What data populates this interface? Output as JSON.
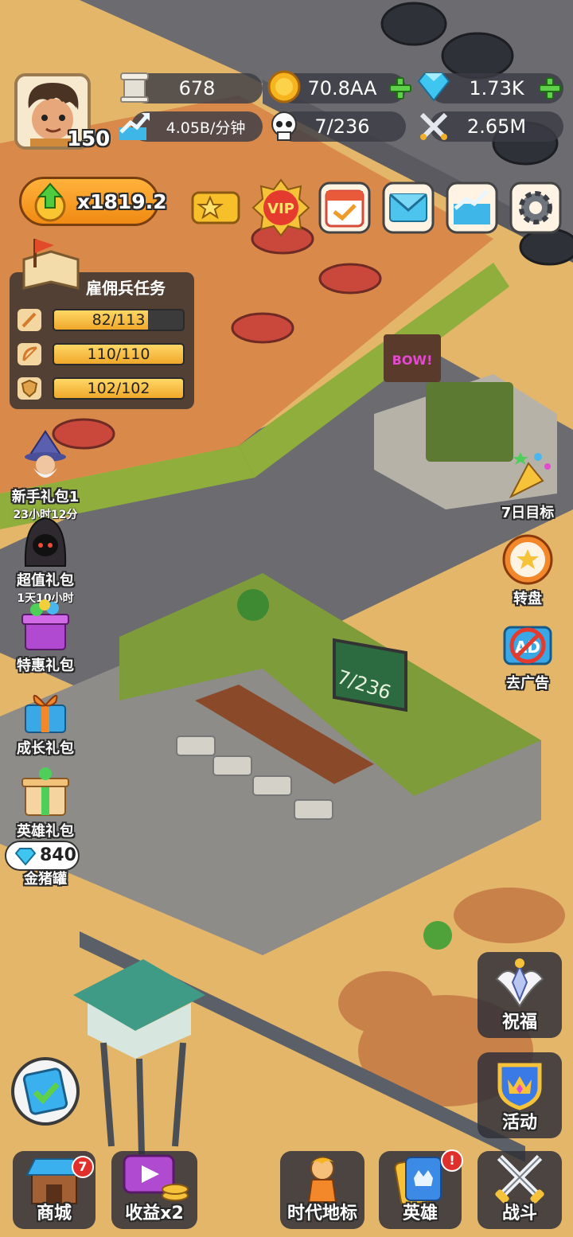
{
  "player": {
    "level": "150"
  },
  "resources": {
    "stone": "678",
    "gold": "70.8AA",
    "diamonds": "1.73K",
    "income_rate": "4.05B/分钟",
    "population": "7/236",
    "power": "2.65M"
  },
  "boost": {
    "multiplier": "x1819.2"
  },
  "top_buttons": [
    {
      "name": "pass-ticket",
      "icon": "ticket-star-icon"
    },
    {
      "name": "vip",
      "label": "VIP",
      "icon": "vip-badge-icon"
    },
    {
      "name": "calendar",
      "icon": "calendar-check-icon"
    },
    {
      "name": "mail",
      "icon": "mail-icon"
    },
    {
      "name": "stats",
      "icon": "chart-icon"
    },
    {
      "name": "settings",
      "icon": "gear-icon"
    }
  ],
  "mission_panel": {
    "title": "雇佣兵任务",
    "bars": [
      {
        "icon": "sword-icon",
        "text": "82/113",
        "progress": 0.726
      },
      {
        "icon": "bow-icon",
        "text": "110/110",
        "progress": 1.0
      },
      {
        "icon": "shield-icon",
        "text": "102/102",
        "progress": 1.0
      }
    ]
  },
  "left_offers": [
    {
      "label": "新手礼包1",
      "timer": "23小时12分",
      "icon": "wizard-icon"
    },
    {
      "label": "超值礼包",
      "timer": "1天10小时",
      "icon": "dark-hood-icon"
    },
    {
      "label": "特惠礼包",
      "icon": "gift-box-icon"
    },
    {
      "label": "成长礼包",
      "icon": "growth-gift-icon"
    },
    {
      "label": "英雄礼包",
      "icon": "hero-gift-icon"
    }
  ],
  "piggy_bank": {
    "diamonds": "840",
    "label": "金猪罐"
  },
  "right_events": [
    {
      "label": "7日目标",
      "icon": "party-popper-icon"
    },
    {
      "label": "转盘",
      "icon": "wheel-icon"
    },
    {
      "label": "去广告",
      "icon": "no-ads-icon"
    }
  ],
  "right_side": [
    {
      "label": "祝福",
      "icon": "blessing-icon"
    },
    {
      "label": "活动",
      "icon": "crown-shield-icon"
    }
  ],
  "bottom_nav": [
    {
      "label": "商城",
      "icon": "shop-icon",
      "badge": "7"
    },
    {
      "label": "收益x2",
      "icon": "video-coins-icon"
    },
    {
      "label": "时代地标",
      "icon": "caveman-icon"
    },
    {
      "label": "英雄",
      "icon": "hero-card-icon",
      "badge": "!"
    },
    {
      "label": "战斗",
      "icon": "crossed-swords-icon"
    }
  ],
  "scene": {
    "board_text": "7/236",
    "wall_sign": "BOW!"
  },
  "colors": {
    "sand": "#e3b66a",
    "road": "#6b6b70",
    "floor": "#d9894a",
    "wall": "#8fae3c",
    "accent_orange": "#f08a13"
  }
}
